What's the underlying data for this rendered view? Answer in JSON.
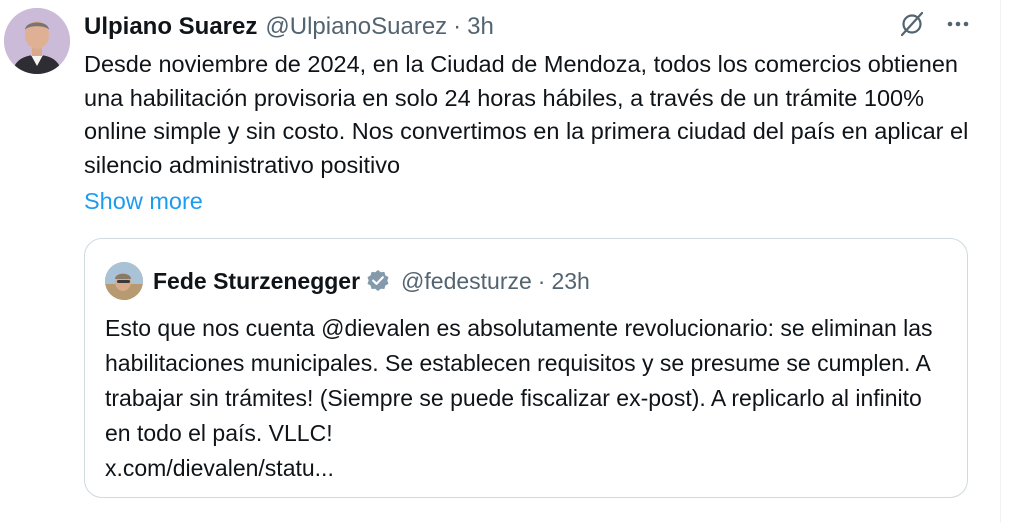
{
  "colors": {
    "text": "#0f1419",
    "secondary": "#536471",
    "link": "#1d9bf0",
    "border": "#cfd9de",
    "verified_badge": "#829aab"
  },
  "tweet": {
    "author": {
      "name": "Ulpiano Suarez",
      "handle": "@UlpianoSuarez",
      "separator": "·",
      "time": "3h",
      "avatar_icon": "profile-photo"
    },
    "actions": {
      "grok_icon": "grok-slash-circle-icon",
      "more_icon": "more-horizontal-icon"
    },
    "text": "Desde noviembre de 2024, en la Ciudad de Mendoza, todos los comercios obtienen una habilitación provisoria en solo 24 horas hábiles, a través de un trámite 100% online simple y sin costo. Nos convertimos en la primera ciudad del país en aplicar el silencio administrativo positivo",
    "show_more": "Show more",
    "quote": {
      "author": {
        "name": "Fede Sturzenegger",
        "verified_icon": "verified-badge-icon",
        "handle": "@fedesturze",
        "separator": "·",
        "time": "23h",
        "avatar_icon": "profile-photo"
      },
      "text": "Esto que nos cuenta @dievalen es absolutamente revolucionario: se eliminan las habilitaciones municipales. Se establecen requisitos y se presume se cumplen. A trabajar sin trámites! (Siempre se puede fiscalizar ex-post). A replicarlo al infinito en todo el país. VLLC!\nx.com/dievalen/statu..."
    }
  }
}
